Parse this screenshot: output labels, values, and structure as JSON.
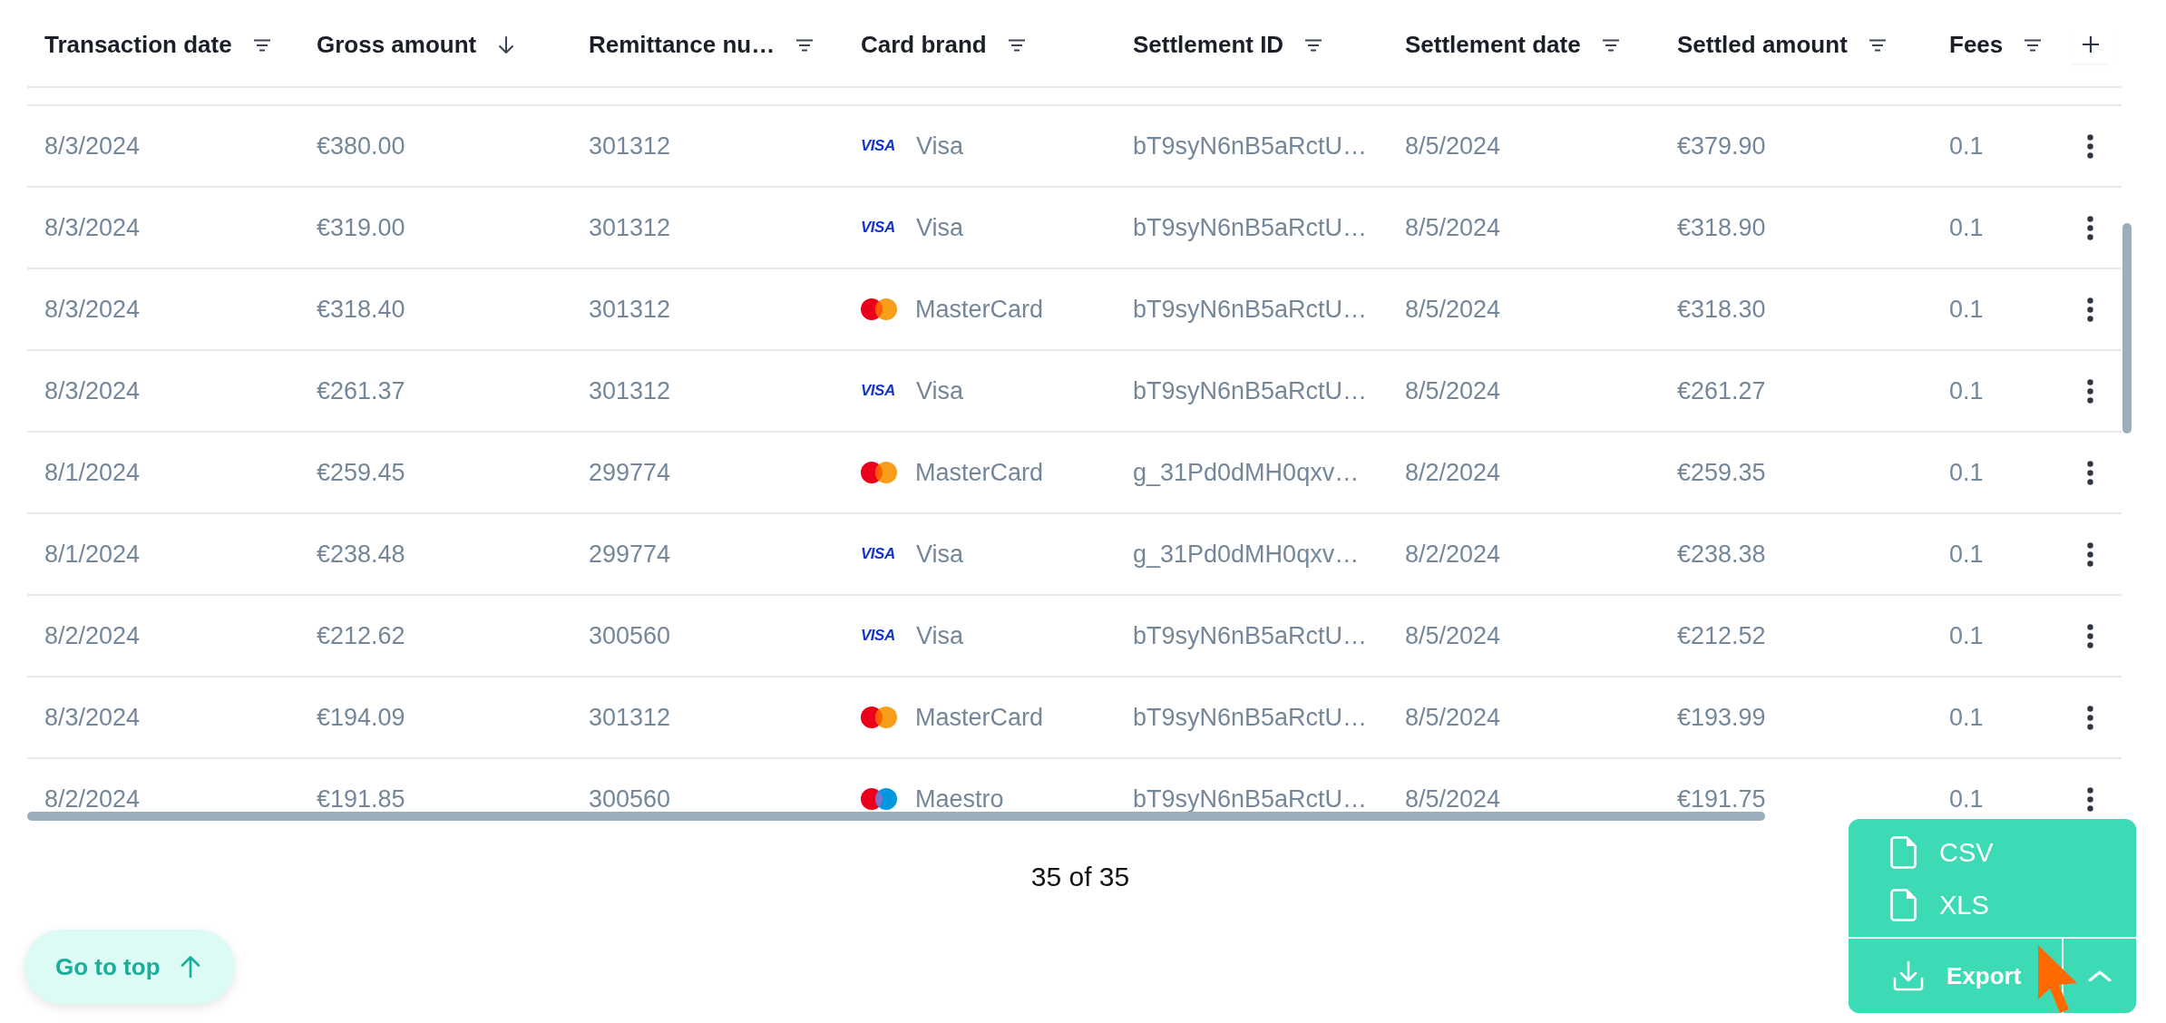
{
  "table": {
    "columns": [
      {
        "label": "Transaction date",
        "sorted": false
      },
      {
        "label": "Gross amount",
        "sorted": true
      },
      {
        "label": "Remittance nu…",
        "sorted": false
      },
      {
        "label": "Card brand",
        "sorted": false
      },
      {
        "label": "Settlement ID",
        "sorted": false
      },
      {
        "label": "Settlement date",
        "sorted": false
      },
      {
        "label": "Settled amount",
        "sorted": false
      },
      {
        "label": "Fees",
        "sorted": false
      }
    ],
    "rows": [
      {
        "transaction_date": "8/3/2024",
        "gross_amount": "€380.00",
        "remittance": "301312",
        "card_brand": {
          "kind": "visa",
          "logo_text": "VISA",
          "name": "Visa"
        },
        "settlement_id": "bT9syN6nB5aRctU…",
        "settlement_date": "8/5/2024",
        "settled_amount": "€379.90",
        "fees": "0.1"
      },
      {
        "transaction_date": "8/3/2024",
        "gross_amount": "€319.00",
        "remittance": "301312",
        "card_brand": {
          "kind": "visa",
          "logo_text": "VISA",
          "name": "Visa"
        },
        "settlement_id": "bT9syN6nB5aRctU…",
        "settlement_date": "8/5/2024",
        "settled_amount": "€318.90",
        "fees": "0.1"
      },
      {
        "transaction_date": "8/3/2024",
        "gross_amount": "€318.40",
        "remittance": "301312",
        "card_brand": {
          "kind": "mastercard",
          "name": "MasterCard"
        },
        "settlement_id": "bT9syN6nB5aRctU…",
        "settlement_date": "8/5/2024",
        "settled_amount": "€318.30",
        "fees": "0.1"
      },
      {
        "transaction_date": "8/3/2024",
        "gross_amount": "€261.37",
        "remittance": "301312",
        "card_brand": {
          "kind": "visa",
          "logo_text": "VISA",
          "name": "Visa"
        },
        "settlement_id": "bT9syN6nB5aRctU…",
        "settlement_date": "8/5/2024",
        "settled_amount": "€261.27",
        "fees": "0.1"
      },
      {
        "transaction_date": "8/1/2024",
        "gross_amount": "€259.45",
        "remittance": "299774",
        "card_brand": {
          "kind": "mastercard",
          "name": "MasterCard"
        },
        "settlement_id": "g_31Pd0dMH0qxv…",
        "settlement_date": "8/2/2024",
        "settled_amount": "€259.35",
        "fees": "0.1"
      },
      {
        "transaction_date": "8/1/2024",
        "gross_amount": "€238.48",
        "remittance": "299774",
        "card_brand": {
          "kind": "visa",
          "logo_text": "VISA",
          "name": "Visa"
        },
        "settlement_id": "g_31Pd0dMH0qxv…",
        "settlement_date": "8/2/2024",
        "settled_amount": "€238.38",
        "fees": "0.1"
      },
      {
        "transaction_date": "8/2/2024",
        "gross_amount": "€212.62",
        "remittance": "300560",
        "card_brand": {
          "kind": "visa",
          "logo_text": "VISA",
          "name": "Visa"
        },
        "settlement_id": "bT9syN6nB5aRctU…",
        "settlement_date": "8/5/2024",
        "settled_amount": "€212.52",
        "fees": "0.1"
      },
      {
        "transaction_date": "8/3/2024",
        "gross_amount": "€194.09",
        "remittance": "301312",
        "card_brand": {
          "kind": "mastercard",
          "name": "MasterCard"
        },
        "settlement_id": "bT9syN6nB5aRctU…",
        "settlement_date": "8/5/2024",
        "settled_amount": "€193.99",
        "fees": "0.1"
      },
      {
        "transaction_date": "8/2/2024",
        "gross_amount": "€191.85",
        "remittance": "300560",
        "card_brand": {
          "kind": "maestro",
          "name": "Maestro"
        },
        "settlement_id": "bT9syN6nB5aRctU…",
        "settlement_date": "8/5/2024",
        "settled_amount": "€191.75",
        "fees": "0.1"
      }
    ]
  },
  "result_count": "35 of 35",
  "go_to_top": {
    "label": "Go to top"
  },
  "export_menu": {
    "expanded": true,
    "options": [
      {
        "label": "CSV"
      },
      {
        "label": "XLS"
      }
    ],
    "button": "Export"
  }
}
